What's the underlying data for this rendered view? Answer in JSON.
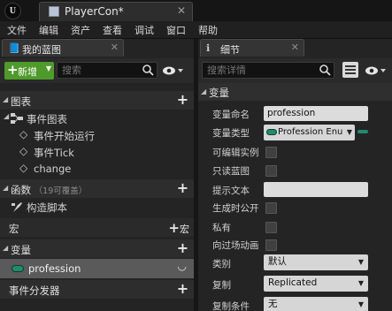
{
  "app": {
    "logo_text": "U",
    "tab_title": "PlayerCon*"
  },
  "menu": [
    "文件",
    "编辑",
    "资产",
    "查看",
    "调试",
    "窗口",
    "帮助"
  ],
  "left_panel": {
    "tab_label": "我的蓝图",
    "new_button": "新增",
    "search_placeholder": "搜索",
    "sections": {
      "graphs": "图表",
      "event_graph": "事件图表",
      "events": [
        "事件开始运行",
        "事件Tick",
        "change"
      ],
      "functions": "函数",
      "functions_note": "（19可覆盖）",
      "construction_script": "构造脚本",
      "macros": "宏",
      "macros_add": "宏",
      "variables": "变量",
      "variable_item": "profession",
      "event_dispatchers": "事件分发器"
    }
  },
  "details_panel": {
    "tab_label": "细节",
    "search_placeholder": "搜索详情",
    "section": "变量",
    "properties": {
      "var_name_label": "变量命名",
      "var_name_value": "profession",
      "var_type_label": "变量类型",
      "var_type_value": "Profession Enu",
      "instance_editable_label": "可编辑实例",
      "readonly_label": "只读蓝图",
      "tooltip_label": "提示文本",
      "tooltip_value": "",
      "expose_spawn_label": "生成时公开",
      "private_label": "私有",
      "expose_cinematics_label": "向过场动画",
      "category_label": "类别",
      "category_value": "默认",
      "replication_label": "复制",
      "replication_value": "Replicated",
      "rep_condition_label": "复制条件",
      "rep_condition_value": "无"
    }
  },
  "colors": {
    "accent_green": "#4e9a2a",
    "enum_pill": "#1f8d6c",
    "background": "#242424"
  }
}
